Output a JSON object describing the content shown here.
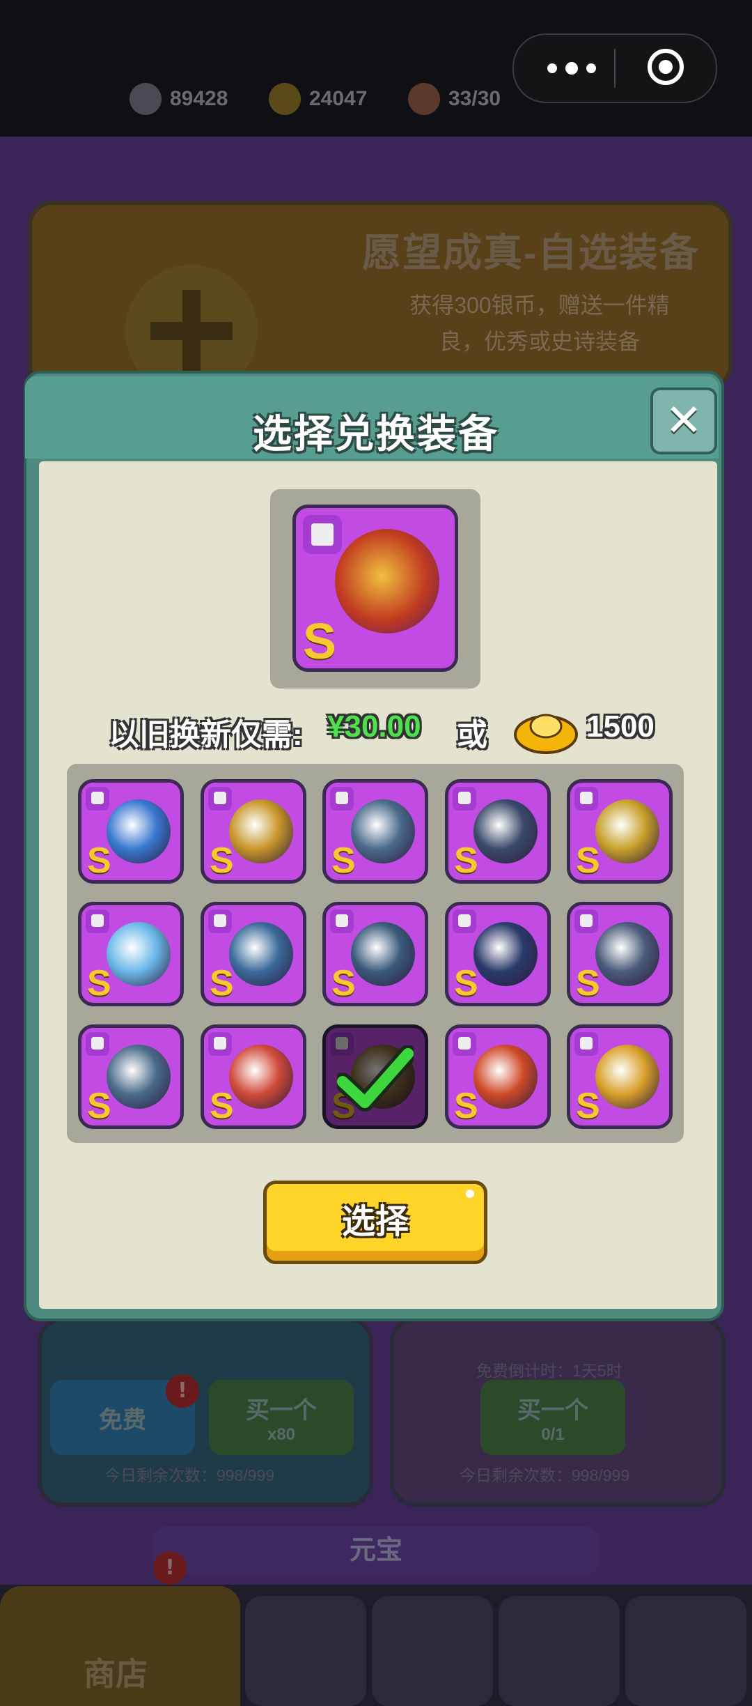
{
  "header": {
    "resources": [
      {
        "name": "silver-coin",
        "value": "89428"
      },
      {
        "name": "gold-ingot",
        "value": "24047"
      },
      {
        "name": "meat-stamina",
        "value": "33/30"
      }
    ]
  },
  "background": {
    "banner_title": "愿望成真-自选装备",
    "banner_desc_line1": "获得300银币，赠送一件精",
    "banner_desc_line2": "良，优秀或史诗装备",
    "free_button": "免费",
    "buy_one": "买一个",
    "buy_cost_ingot": "x80",
    "buy_cost_ticket": "0/1",
    "countdown": "免费倒计时：1天5时",
    "remaining_left": "今日剩余次数：998/999",
    "remaining_right": "今日剩余次数：998/999",
    "section_title": "元宝",
    "nav_shop": "商店"
  },
  "modal": {
    "title": "选择兑换装备",
    "selected_grade": "S",
    "price_label": "以旧换新仅需:",
    "price_value": "¥30.00",
    "or_text": "或",
    "gold_cost": "1500",
    "select_button": "选择",
    "items": [
      {
        "slot": "helmet",
        "grade": "S",
        "color": "#3a78d0"
      },
      {
        "slot": "armor",
        "grade": "S",
        "color": "#c8962a"
      },
      {
        "slot": "boots",
        "grade": "S",
        "color": "#4a6a8a"
      },
      {
        "slot": "amulet",
        "grade": "S",
        "color": "#3a4a6a"
      },
      {
        "slot": "gloves",
        "grade": "S",
        "color": "#c8a02a"
      },
      {
        "slot": "sword",
        "grade": "S",
        "color": "#6ab8e8"
      },
      {
        "slot": "amulet",
        "grade": "S",
        "color": "#3a6a9a"
      },
      {
        "slot": "gloves",
        "grade": "S",
        "color": "#3a5a7a"
      },
      {
        "slot": "helmet",
        "grade": "S",
        "color": "#2a3a6a"
      },
      {
        "slot": "armor",
        "grade": "S",
        "color": "#4a5a7a"
      },
      {
        "slot": "boots",
        "grade": "S",
        "color": "#4a6a8a"
      },
      {
        "slot": "sword",
        "grade": "S",
        "color": "#d04a3a"
      },
      {
        "slot": "armor",
        "grade": "S",
        "color": "#8a6a3a",
        "selected": true
      },
      {
        "slot": "amulet",
        "grade": "S",
        "color": "#d04a2a"
      },
      {
        "slot": "gloves",
        "grade": "S",
        "color": "#d8a02a"
      }
    ]
  }
}
